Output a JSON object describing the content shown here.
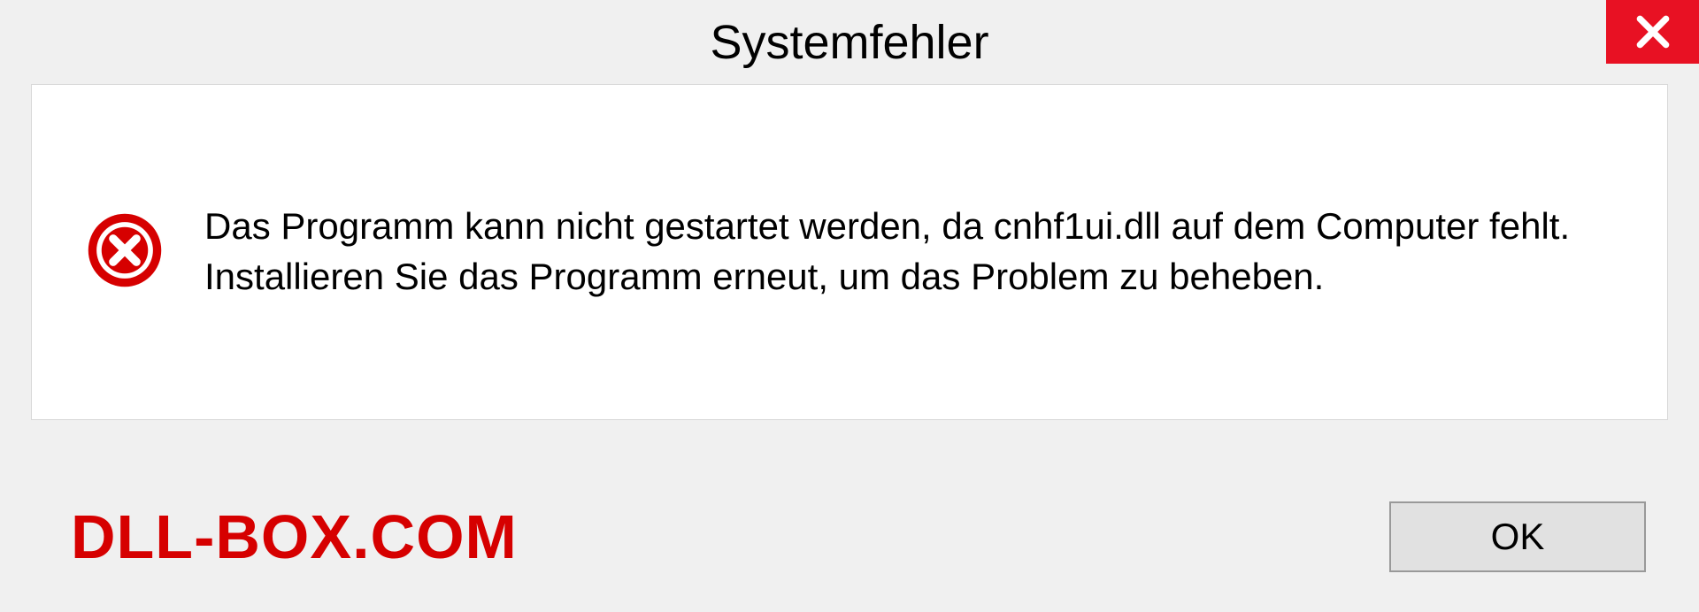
{
  "dialog": {
    "title": "Systemfehler",
    "message": "Das Programm kann nicht gestartet werden, da cnhf1ui.dll auf dem Computer fehlt. Installieren Sie das Programm erneut, um das Problem zu beheben.",
    "ok_label": "OK"
  },
  "watermark": "DLL-BOX.COM",
  "colors": {
    "close_bg": "#e81123",
    "error_icon": "#d60000",
    "watermark": "#d60000"
  }
}
